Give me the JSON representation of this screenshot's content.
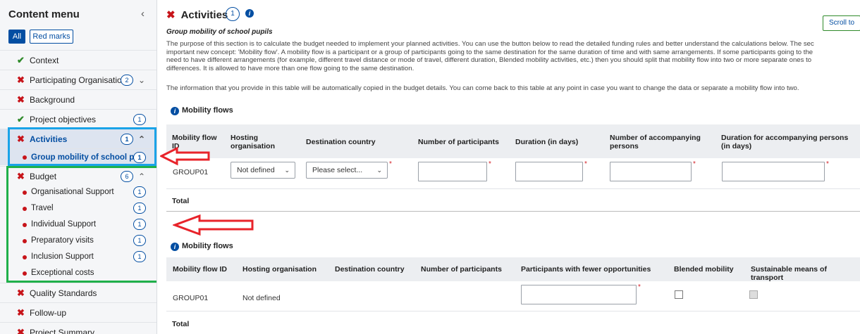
{
  "sidebar": {
    "title": "Content menu",
    "collapse_icon": "chevron-left-icon",
    "filters": {
      "all": "All",
      "red_marks": "Red marks"
    },
    "items": [
      {
        "label": "Context",
        "status": "ok"
      },
      {
        "label": "Participating Organisations",
        "status": "bad",
        "badge": "2"
      },
      {
        "label": "Background",
        "status": "bad"
      },
      {
        "label": "Project objectives",
        "status": "ok",
        "badge": "1"
      },
      {
        "label": "Activities",
        "status": "bad",
        "badge": "1"
      },
      {
        "label": "Group mobility of school pu...",
        "badge": "1"
      },
      {
        "label": "Budget",
        "status": "bad",
        "badge": "6"
      },
      {
        "label": "Organisational Support",
        "badge": "1"
      },
      {
        "label": "Travel",
        "badge": "1"
      },
      {
        "label": "Individual Support",
        "badge": "1"
      },
      {
        "label": "Preparatory visits",
        "badge": "1"
      },
      {
        "label": "Inclusion Support",
        "badge": "1"
      },
      {
        "label": "Exceptional costs"
      },
      {
        "label": "Quality Standards",
        "status": "bad"
      },
      {
        "label": "Follow-up",
        "status": "bad"
      },
      {
        "label": "Project Summary",
        "status": "bad"
      }
    ]
  },
  "main": {
    "title": "Activities",
    "title_badge": "1",
    "scroll_button": "Scroll to",
    "subtitle": "Group mobility of school pupils",
    "paragraph_lines": [
      "The purpose of this section is to calculate the budget needed to implement your planned activities. You can use the button below to read the detailed funding rules and better understand the calculations below. The sec",
      "important new concept: 'Mobility flow'. A mobility flow is a participant or a group of participants going to the same destination for the same duration of time and with same arrangements. If some participants going to the",
      "need to have different arrangements (for example, different travel distance or mode of travel, different duration, Blended mobility activities, etc.) then you should split that mobility flow into two or more separate ones to",
      "differences. It is allowed to have more than one flow going to the same destination."
    ],
    "paragraph2": "The information that you provide in this table will be automatically copied in the budget details. You can come back to this table at any point in case you want to change the data or separate a mobility flow into two.",
    "table1": {
      "title": "Mobility flows",
      "headers": {
        "id": "Mobility flow ID",
        "hosting": "Hosting organisation",
        "destination": "Destination country",
        "participants": "Number of participants",
        "duration": "Duration (in days)",
        "accompanying": "Number of accompanying persons",
        "acc_duration": "Duration for accompanying persons (in days)"
      },
      "row": {
        "id": "GROUP01",
        "hosting_value": "Not defined",
        "destination_value": "Please select...",
        "participants_value": "",
        "duration_value": "",
        "accompanying_value": "",
        "acc_duration_value": ""
      },
      "total": "Total"
    },
    "table2": {
      "title": "Mobility flows",
      "headers": {
        "id": "Mobility flow ID",
        "hosting": "Hosting organisation",
        "destination": "Destination country",
        "participants": "Number of participants",
        "fewer": "Participants with fewer opportunities",
        "blended": "Blended mobility",
        "sustainable": "Sustainable means of transport"
      },
      "row": {
        "id": "GROUP01",
        "hosting": "Not defined",
        "fewer_value": "",
        "blended_checked": false,
        "sustainable_checked": false
      },
      "total": "Total"
    }
  },
  "colors": {
    "accent": "#034ea2",
    "error": "#c7141a",
    "ok": "#2f8a2a",
    "highlight_blue": "#1aa3e8",
    "highlight_green": "#1fb04a",
    "arrow_red": "#e8232a"
  }
}
